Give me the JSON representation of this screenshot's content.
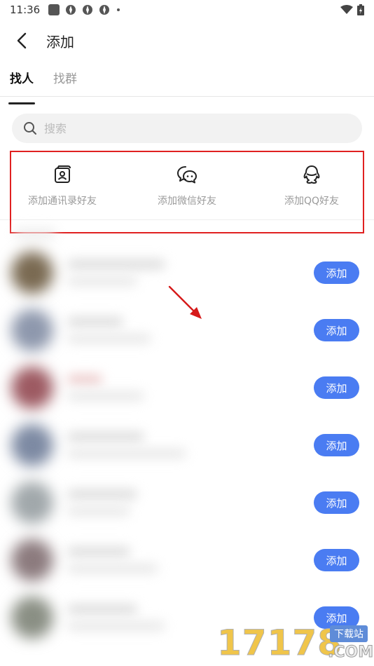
{
  "status_bar": {
    "time": "11:36"
  },
  "header": {
    "title": "添加"
  },
  "tabs": [
    {
      "label": "找人",
      "active": true
    },
    {
      "label": "找群",
      "active": false
    }
  ],
  "search": {
    "placeholder": "搜索",
    "value": ""
  },
  "quick_actions": [
    {
      "label": "添加通讯录好友",
      "icon": "contacts-book-icon"
    },
    {
      "label": "添加微信好友",
      "icon": "wechat-icon"
    },
    {
      "label": "添加QQ好友",
      "icon": "qq-icon"
    }
  ],
  "suggestions": {
    "add_label": "添加",
    "rows": [
      {
        "avatar_color": "#7a6a52"
      },
      {
        "avatar_color": "#8e98ad"
      },
      {
        "avatar_color": "#9d5a62"
      },
      {
        "avatar_color": "#7d8aa3"
      },
      {
        "avatar_color": "#a1a8ab"
      },
      {
        "avatar_color": "#8c7b7e"
      },
      {
        "avatar_color": "#8a8f84"
      }
    ]
  },
  "accent_color": "#4a7cf2",
  "annotation_color": "#e02020",
  "watermark": {
    "digits": "17178",
    "tag": "下载站",
    "domain": ".COM"
  }
}
